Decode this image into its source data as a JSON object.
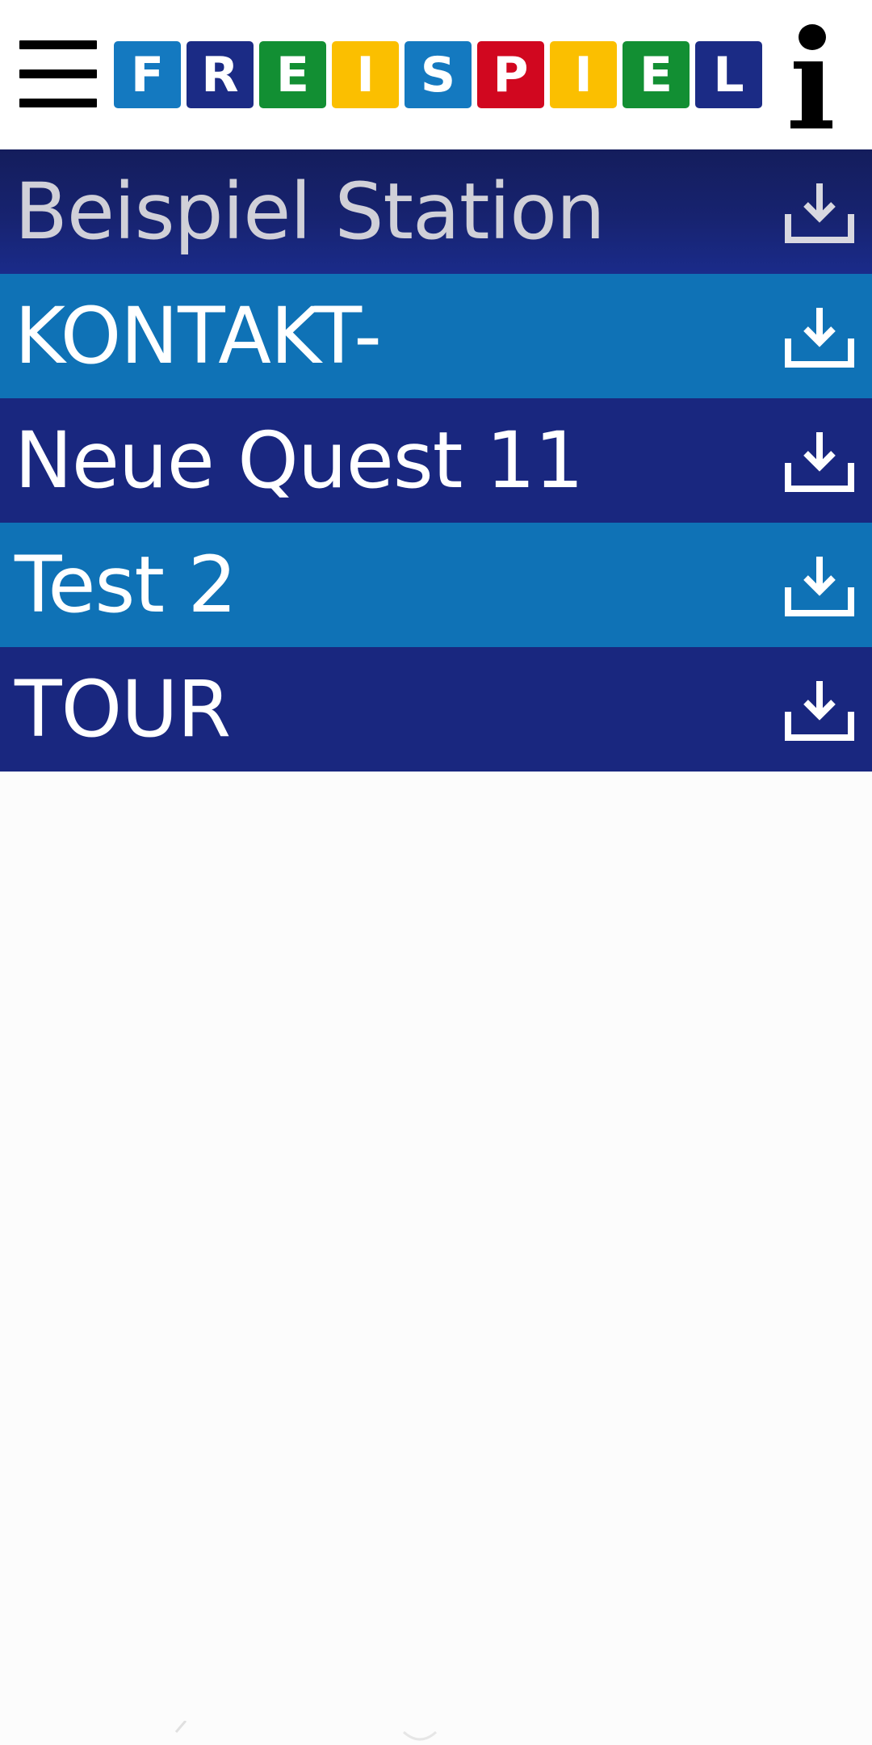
{
  "colors": {
    "header_bg": "#ffffff",
    "row_dark": "#19277f",
    "row_light": "#0f72b6",
    "row_first_top": "#141d5c",
    "text": "#ffffff",
    "first_row_text": "#d0d0d8",
    "page_bg": "#fcfcfc"
  },
  "header": {
    "menu_icon": "hamburger-menu-icon",
    "info_icon": "info-icon",
    "logo": {
      "text": "FREISPIEL",
      "tiles": [
        {
          "letter": "F",
          "color": "#1479c0"
        },
        {
          "letter": "R",
          "color": "#1b2b85"
        },
        {
          "letter": "E",
          "color": "#128f33"
        },
        {
          "letter": "I",
          "color": "#fbbf00"
        },
        {
          "letter": "S",
          "color": "#1479c0"
        },
        {
          "letter": "P",
          "color": "#d1071f"
        },
        {
          "letter": "I",
          "color": "#fbbf00"
        },
        {
          "letter": "E",
          "color": "#128f33"
        },
        {
          "letter": "L",
          "color": "#1b2b85"
        }
      ]
    }
  },
  "quests": [
    {
      "label": "Beispiel Station",
      "icon": "download-icon"
    },
    {
      "label": "KONTAKT-",
      "icon": "download-icon"
    },
    {
      "label": "Neue Quest 11",
      "icon": "download-icon"
    },
    {
      "label": "Test 2",
      "icon": "download-icon"
    },
    {
      "label": "TOUR",
      "icon": "download-icon"
    }
  ]
}
